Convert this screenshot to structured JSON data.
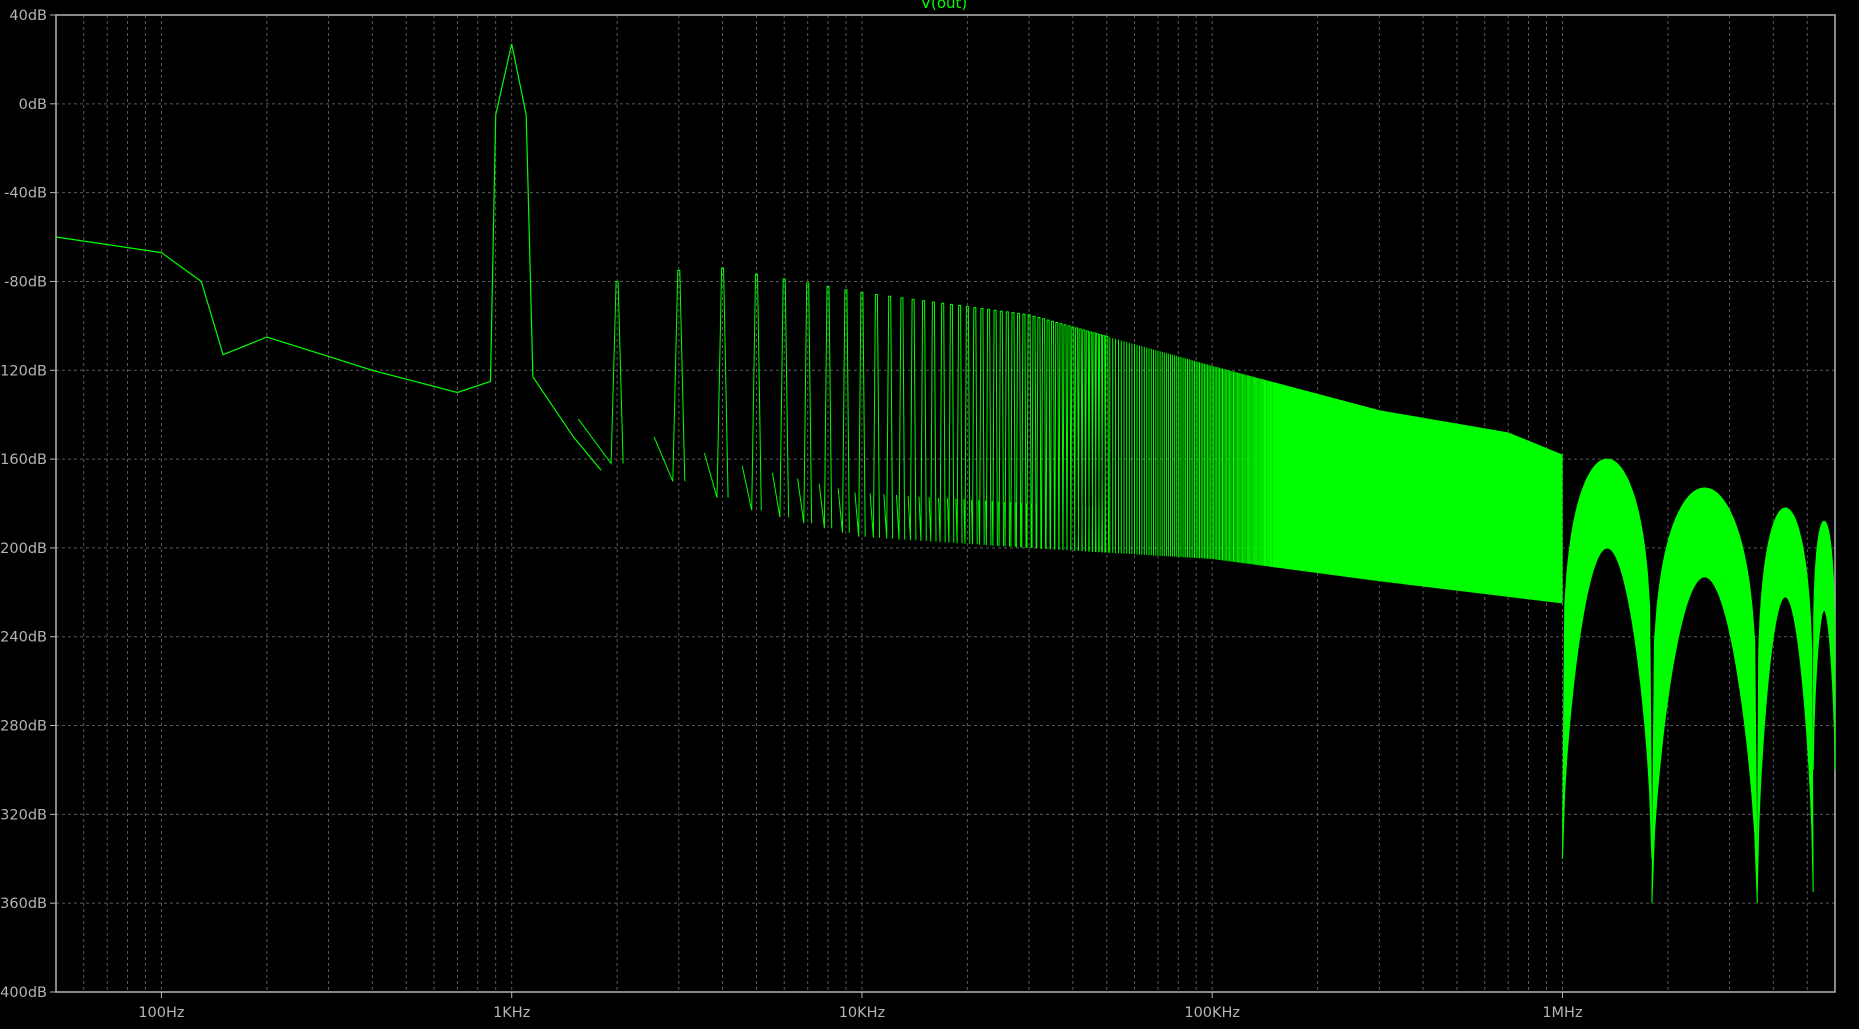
{
  "chart_data": {
    "type": "line",
    "title": "V(out)",
    "x_scale": "log",
    "xlim_hz": [
      50,
      6000000
    ],
    "ylim_db": [
      -400,
      40
    ],
    "grid": true,
    "x_tick_labels": [
      "100Hz",
      "1KHz",
      "10KHz",
      "100KHz",
      "1MHz"
    ],
    "x_tick_values_hz": [
      100,
      1000,
      10000,
      100000,
      1000000
    ],
    "y_tick_labels": [
      "40dB",
      "0dB",
      "-40dB",
      "-80dB",
      "-120dB",
      "-160dB",
      "-200dB",
      "-240dB",
      "-280dB",
      "-320dB",
      "-360dB",
      "-400dB"
    ],
    "y_tick_values_db": [
      40,
      0,
      -40,
      -80,
      -120,
      -160,
      -200,
      -240,
      -280,
      -320,
      -360,
      -400
    ],
    "series": [
      {
        "name": "V(out)",
        "color": "#00ff00",
        "fundamental_hz": 1000,
        "fundamental_peak_db": 27,
        "low_freq_curve": [
          {
            "x": 50,
            "y": -60
          },
          {
            "x": 100,
            "y": -67
          },
          {
            "x": 130,
            "y": -80
          },
          {
            "x": 150,
            "y": -113
          },
          {
            "x": 200,
            "y": -105
          },
          {
            "x": 400,
            "y": -120
          },
          {
            "x": 700,
            "y": -130
          },
          {
            "x": 870,
            "y": -125
          },
          {
            "x": 900,
            "y": -5
          },
          {
            "x": 1000,
            "y": 27
          },
          {
            "x": 1100,
            "y": -5
          },
          {
            "x": 1150,
            "y": -123
          },
          {
            "x": 1500,
            "y": -150
          },
          {
            "x": 1800,
            "y": -165
          }
        ],
        "harmonic_peak_envelope": [
          {
            "x": 2000,
            "y": -80
          },
          {
            "x": 3000,
            "y": -75
          },
          {
            "x": 4000,
            "y": -74
          },
          {
            "x": 10000,
            "y": -85
          },
          {
            "x": 30000,
            "y": -95
          },
          {
            "x": 100000,
            "y": -118
          },
          {
            "x": 300000,
            "y": -138
          },
          {
            "x": 700000,
            "y": -148
          },
          {
            "x": 1000000,
            "y": -158
          }
        ],
        "harmonic_floor_envelope": [
          {
            "x": 2000,
            "y": -162
          },
          {
            "x": 3000,
            "y": -170
          },
          {
            "x": 5000,
            "y": -183
          },
          {
            "x": 10000,
            "y": -195
          },
          {
            "x": 30000,
            "y": -200
          },
          {
            "x": 100000,
            "y": -205
          },
          {
            "x": 300000,
            "y": -215
          },
          {
            "x": 1000000,
            "y": -225
          }
        ],
        "hf_lobes": [
          {
            "from_hz": 1000000,
            "to_hz": 1800000,
            "peak_db": -160,
            "null_db": -340
          },
          {
            "from_hz": 1800000,
            "to_hz": 3600000,
            "peak_db": -173,
            "null_db": -360
          },
          {
            "from_hz": 3600000,
            "to_hz": 5200000,
            "peak_db": -182,
            "null_db": -355
          },
          {
            "from_hz": 5200000,
            "to_hz": 6000000,
            "peak_db": -188,
            "null_db": -300
          }
        ]
      }
    ]
  }
}
